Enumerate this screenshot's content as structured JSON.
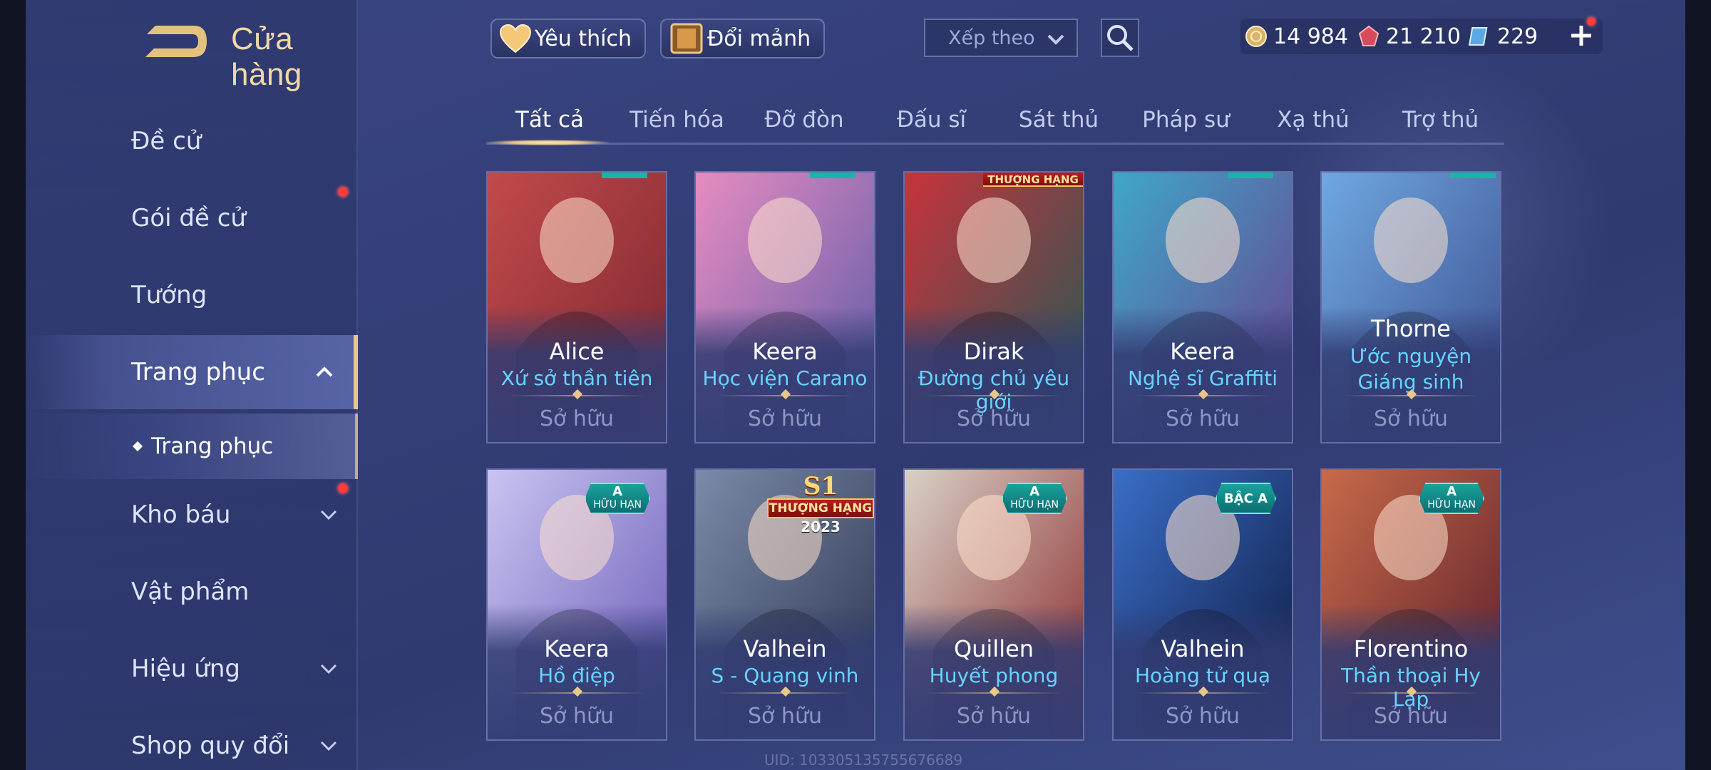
{
  "header": {
    "title": "Cửa hàng",
    "favorite_label": "Yêu thích",
    "exchange_label": "Đổi mảnh",
    "sort_placeholder": "Xếp theo"
  },
  "currencies": [
    {
      "icon": "gold-coin-icon",
      "value": "14 984"
    },
    {
      "icon": "red-gem-icon",
      "value": "21 210"
    },
    {
      "icon": "voucher-icon",
      "value": "229"
    }
  ],
  "sidebar": {
    "items": [
      {
        "label": "Đề cử"
      },
      {
        "label": "Gói đề cử"
      },
      {
        "label": "Tướng"
      },
      {
        "label": "Trang phục"
      },
      {
        "label": "Kho báu"
      },
      {
        "label": "Vật phẩm"
      },
      {
        "label": "Hiệu ứng"
      },
      {
        "label": "Shop quy đổi"
      }
    ],
    "sub_item": "Trang phục"
  },
  "tabs": [
    "Tất cả",
    "Tiến hóa",
    "Đỡ đòn",
    "Đấu sĩ",
    "Sát thủ",
    "Pháp sư",
    "Xạ thủ",
    "Trợ thủ"
  ],
  "cards": [
    {
      "hero": "Alice",
      "skin": "Xứ sở thần tiên",
      "status": "Sở hữu",
      "palette": [
        "#c24a4a",
        "#7a2630"
      ]
    },
    {
      "hero": "Keera",
      "skin": "Học viện Carano",
      "status": "Sở hữu",
      "palette": [
        "#e68cc0",
        "#5a5aa8"
      ]
    },
    {
      "hero": "Dirak",
      "skin": "Đường chủ yêu giới",
      "status": "Sở hữu",
      "palette": [
        "#c8333c",
        "#1f5a55"
      ],
      "top_badge": "THƯỢNG HẠNG"
    },
    {
      "hero": "Keera",
      "skin": "Nghệ sĩ Graffiti",
      "status": "Sở hữu",
      "palette": [
        "#3fa7c9",
        "#6a3f8e"
      ]
    },
    {
      "hero": "Thorne",
      "skin": "Ước nguyện Giáng sinh",
      "status": "Sở hữu",
      "palette": [
        "#6fa8e0",
        "#3b4d8e"
      ]
    },
    {
      "hero": "Keera",
      "skin": "Hồ điệp",
      "status": "Sở hữu",
      "palette": [
        "#c8c4f0",
        "#6a5ab8"
      ],
      "badge": {
        "grade": "A",
        "text": "HỮU HẠN"
      }
    },
    {
      "hero": "Valhein",
      "skin": "S - Quang vinh",
      "status": "Sở hữu",
      "palette": [
        "#7a8aa8",
        "#2d3650"
      ],
      "s1_badge": {
        "season": "S1",
        "label": "THƯỢNG HẠNG",
        "year": "2023"
      }
    },
    {
      "hero": "Quillen",
      "skin": "Huyết phong",
      "status": "Sở hữu",
      "palette": [
        "#d8d0c8",
        "#8a2a2a"
      ],
      "badge": {
        "grade": "A",
        "text": "HỮU HẠN"
      }
    },
    {
      "hero": "Valhein",
      "skin": "Hoàng tử quạ",
      "status": "Sở hữu",
      "palette": [
        "#3a6ec8",
        "#0e1a40"
      ],
      "badge": {
        "grade": "BẬC A",
        "text": ""
      }
    },
    {
      "hero": "Florentino",
      "skin": "Thần thoại Hy Lạp",
      "status": "Sở hữu",
      "palette": [
        "#c86a4a",
        "#5a1e2a"
      ],
      "badge": {
        "grade": "A",
        "text": "HỮU HẠN"
      }
    }
  ],
  "footer": {
    "uid": "UID: 103305135755676689"
  },
  "colors": {
    "accent_gold": "#e8c88a",
    "skin_name": "#67d3ff",
    "owned": "#8e96c4",
    "notification": "#ff3b3b"
  }
}
